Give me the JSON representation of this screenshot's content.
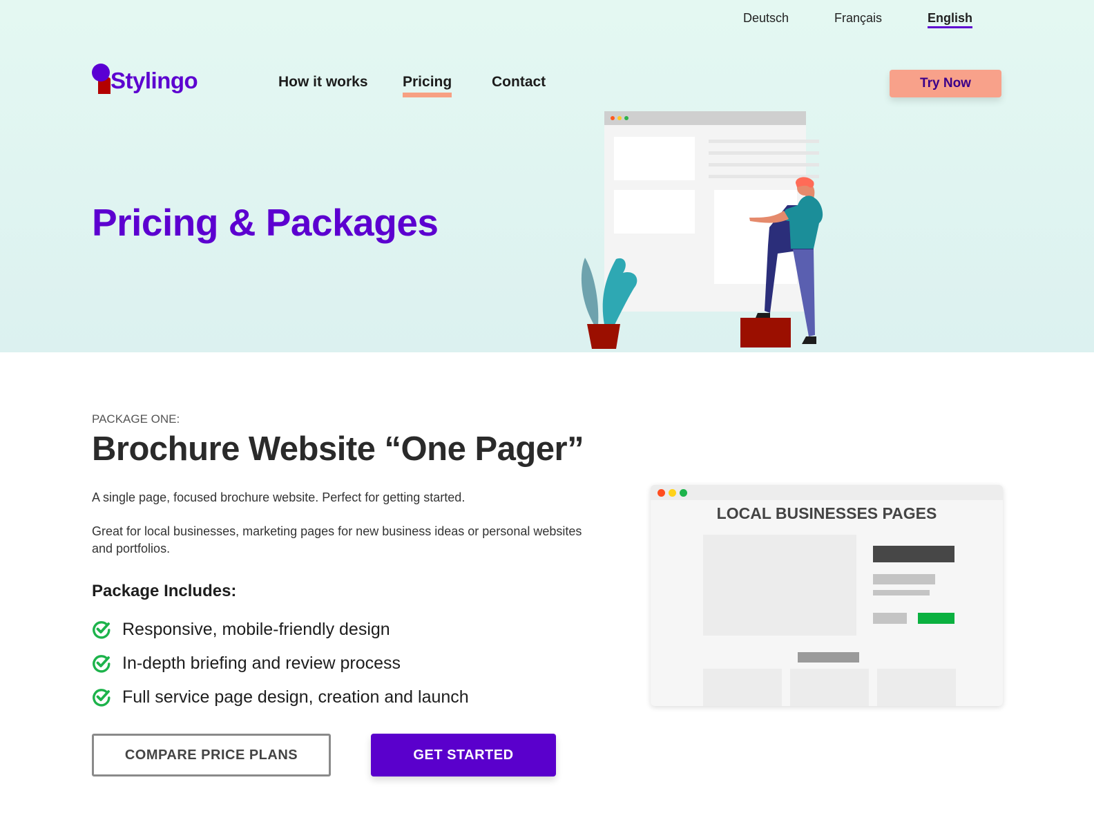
{
  "languages": [
    {
      "label": "Deutsch",
      "active": false
    },
    {
      "label": "Français",
      "active": false
    },
    {
      "label": "English",
      "active": true
    }
  ],
  "brand": {
    "name": "Stylingo"
  },
  "nav": {
    "items": [
      {
        "label": "How it works",
        "active": false
      },
      {
        "label": "Pricing",
        "active": true
      },
      {
        "label": "Contact",
        "active": false
      }
    ],
    "cta": "Try Now"
  },
  "hero": {
    "title": "Pricing & Packages"
  },
  "package": {
    "eyebrow": "PACKAGE ONE:",
    "title": "Brochure Website “One Pager”",
    "description_1": "A single page, focused brochure website. Perfect for getting started.",
    "description_2": "Great for local businesses, marketing pages for new business ideas or personal websites and portfolios.",
    "includes_title": "Package Includes:",
    "features": [
      "Responsive, mobile-friendly design",
      "In-depth briefing and review process",
      "Full service page design, creation and launch"
    ],
    "secondary_button": "COMPARE PRICE PLANS",
    "primary_button": "GET STARTED",
    "preview_title": "LOCAL BUSINESSES PAGES"
  },
  "colors": {
    "brand": "#5c00d0",
    "accent": "#f8a18a",
    "check": "#1db34b",
    "hero_bg": "#e2f6f2"
  }
}
